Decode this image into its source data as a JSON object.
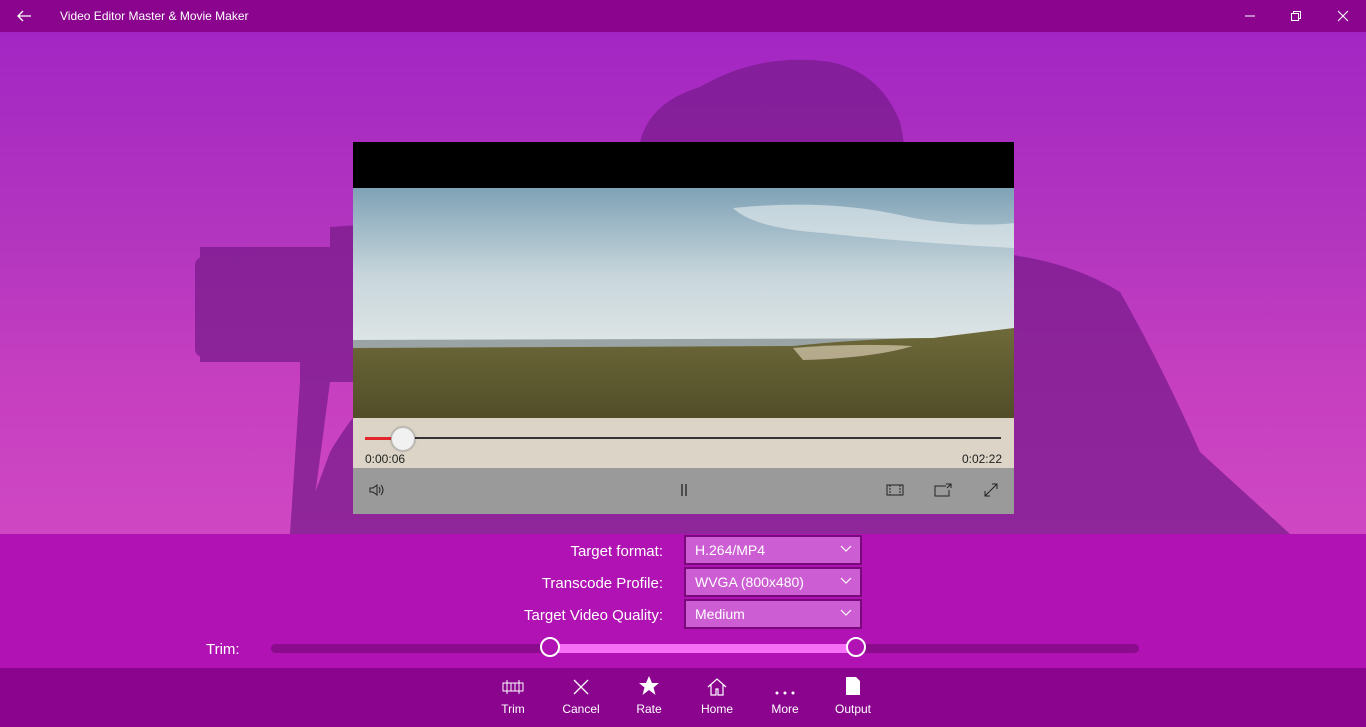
{
  "window": {
    "title": "Video Editor Master & Movie Maker",
    "icons": {
      "back": "back-arrow-icon",
      "minimize": "minimize-icon",
      "maximize": "restore-icon",
      "close": "close-icon"
    }
  },
  "player": {
    "current_time": "0:00:06",
    "total_time": "0:02:22",
    "progress": 0.06,
    "icons": [
      "volume-icon",
      "pause-icon",
      "aspect-ratio-icon",
      "cast-icon",
      "fullscreen-icon"
    ]
  },
  "settings": {
    "target_format": {
      "label": "Target format:",
      "value": "H.264/MP4"
    },
    "transcode_profile": {
      "label": "Transcode Profile:",
      "value": "WVGA (800x480)"
    },
    "target_quality": {
      "label": "Target Video Quality:",
      "value": "Medium"
    },
    "trim": {
      "label": "Trim:",
      "start_fraction": 0.322,
      "end_fraction": 0.674
    }
  },
  "commandbar": {
    "items": [
      {
        "label": "Trim",
        "icon": "trim-icon"
      },
      {
        "label": "Cancel",
        "icon": "cancel-icon"
      },
      {
        "label": "Rate",
        "icon": "star-icon"
      },
      {
        "label": "Home",
        "icon": "home-icon"
      },
      {
        "label": "More",
        "icon": "more-icon"
      },
      {
        "label": "Output",
        "icon": "output-icon"
      }
    ]
  },
  "colors": {
    "accent": "#b012b3",
    "bar": "#8a048e",
    "seek": "#e3262c",
    "trim_range": "#f570f5"
  }
}
